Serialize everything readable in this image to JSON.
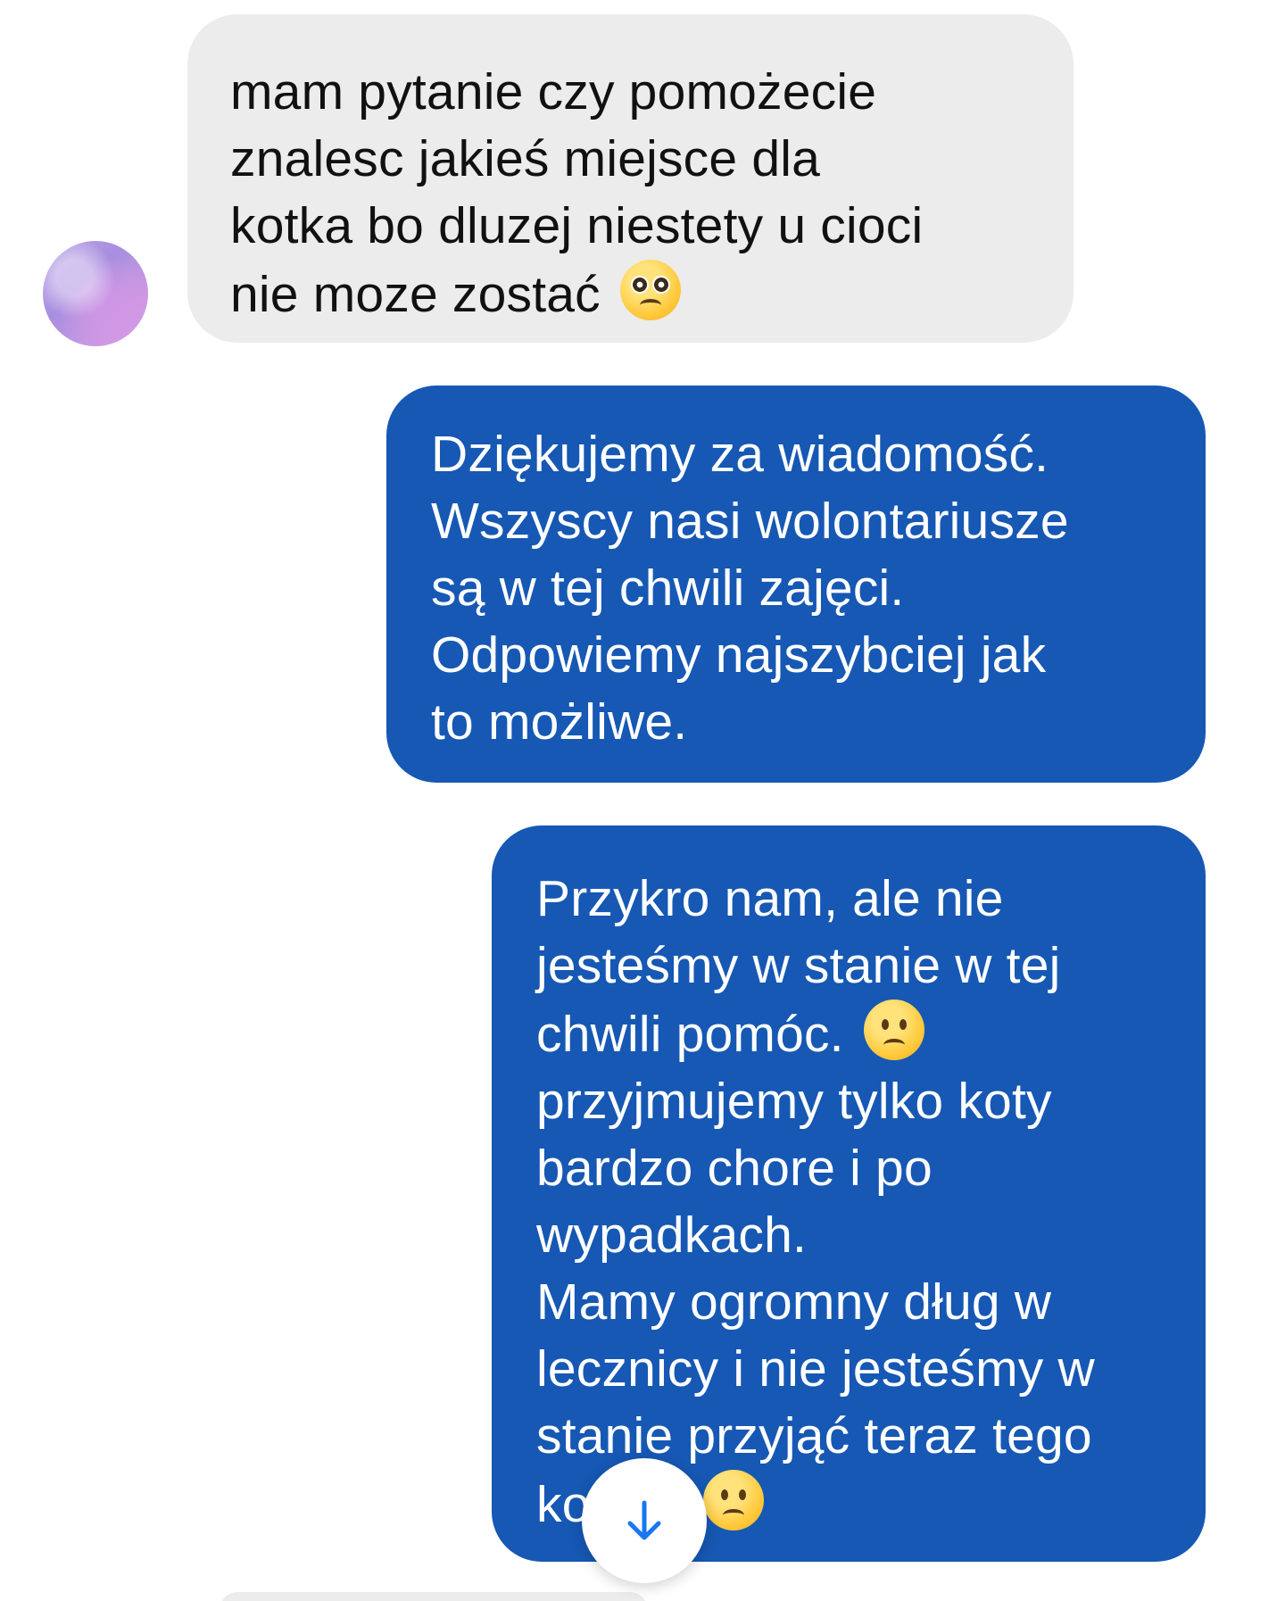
{
  "conversation": {
    "messages": [
      {
        "direction": "incoming",
        "text": "mam pytanie czy pomożecie\nznalesc jakieś miejsce dla\nkotka bo dluzej niestety u cioci\nnie moze zostać",
        "emoji": "pleading-face"
      },
      {
        "direction": "outgoing",
        "text": "Dziękujemy za wiadomość.\nWszyscy nasi wolontariusze\nsą w tej chwili zajęci.\nOdpowiemy najszybciej jak\nto możliwe."
      },
      {
        "direction": "outgoing",
        "text_part1": "Przykro nam, ale nie\njesteśmy w stanie w tej\nchwili pomóc.",
        "emoji_1": "slightly-frowning-face",
        "text_part2": "\nprzyjmujemy tylko koty\nbardzo chore i po\nwypadkach.\nMamy ogromny dług w\nlecznicy i nie jesteśmy w\nstanie przyjąć teraz tego\nko",
        "emoji_2": "slightly-frowning-face"
      }
    ]
  },
  "colors": {
    "incoming_bubble": "#ececec",
    "outgoing_bubble": "#1658b4",
    "scroll_arrow": "#1877f2"
  },
  "icons": {
    "scroll_down": "arrow-down-icon"
  }
}
